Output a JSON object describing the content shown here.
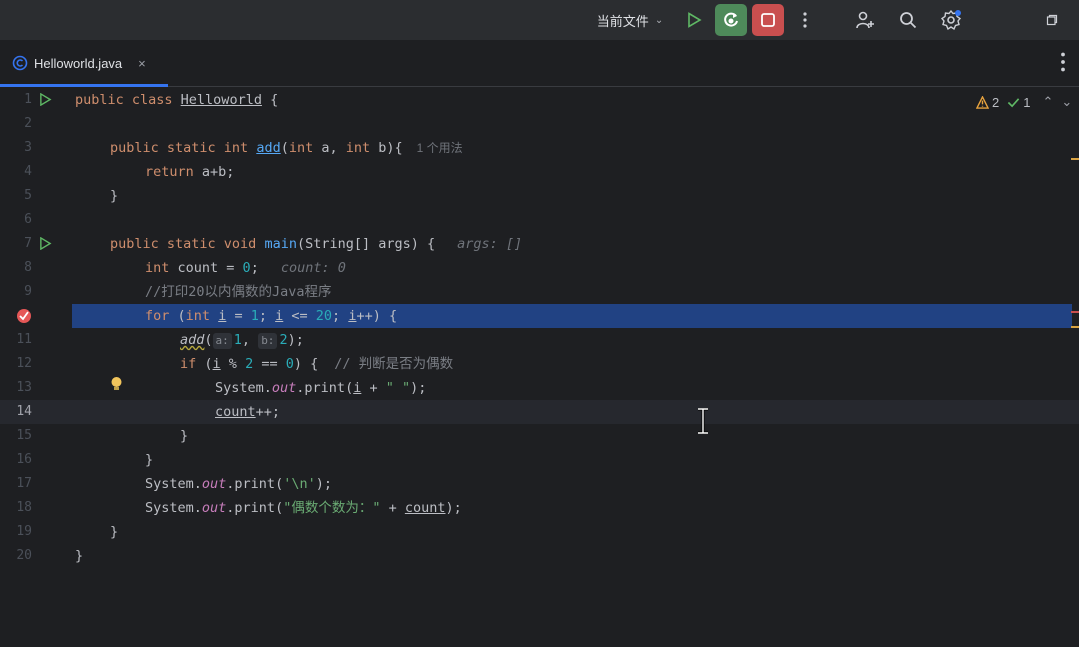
{
  "toolbar": {
    "run_config": "当前文件",
    "icons": [
      "chevron-down-icon",
      "run-icon",
      "rerun-icon",
      "stop-icon",
      "more-icon",
      "add-user-icon",
      "search-icon",
      "settings-icon",
      "window-icon"
    ],
    "colors": {
      "rerun_bg": "#4e8a5a",
      "stop_bg": "#c94f4f",
      "run_green": "#5fb865",
      "accent": "#3574f0"
    }
  },
  "tabs": [
    {
      "label": "Helloworld.java",
      "close": "×"
    }
  ],
  "inspections": {
    "warnings": "2",
    "ok": "1"
  },
  "line_numbers": [
    "1",
    "2",
    "3",
    "4",
    "5",
    "6",
    "7",
    "8",
    "9",
    "10",
    "11",
    "12",
    "13",
    "14",
    "15",
    "16",
    "17",
    "18",
    "19",
    "20"
  ],
  "code": {
    "l1": {
      "kw": "public class ",
      "name": "Helloworld",
      "rest": " {"
    },
    "l3": {
      "kw1": "public static int ",
      "fn": "add",
      "p1": "(",
      "kw2": "int",
      " a": " a, ",
      "kw3": "int",
      "rest": " b){",
      "lens": "1 个用法"
    },
    "l4": {
      "kw": "return",
      "rest": " a+b;"
    },
    "l5": {
      "text": "}"
    },
    "l7": {
      "kw": "public static void ",
      "fn": "main",
      "rest": "(String[] args) {",
      "hint": "args: []"
    },
    "l8": {
      "kw": "int",
      "rest1": " count = ",
      "num": "0",
      "rest2": ";",
      "hint": "count: 0"
    },
    "l9": {
      "cmt": "//打印20以内偶数的Java程序"
    },
    "l10": {
      "kw1": "for",
      "p1": " (",
      "kw2": "int",
      "i1": "i",
      "p2": " = ",
      "n1": "1",
      "p3": "; ",
      "i2": "i",
      "p4": " <= ",
      "n2": "20",
      "p5": "; ",
      "i3": "i",
      "p6": "++) {"
    },
    "l11": {
      "fn": "add",
      "p1": "(",
      "h1": "a:",
      "n1": "1",
      "p2": ", ",
      "h2": "b:",
      "n2": "2",
      "p3": ");"
    },
    "l12": {
      "kw": "if",
      "p1": " (",
      "i": "i",
      "p2": " % ",
      "n1": "2",
      "p3": " == ",
      "n2": "0",
      "p4": ") {",
      "cmt": "// 判断是否为偶数"
    },
    "l13": {
      "p1": "System.",
      "fld": "out",
      "p2": ".print(",
      "i": "i",
      "p3": " + ",
      "str": "\" \"",
      "p4": ");"
    },
    "l14": {
      "v": "count",
      "rest": "++;"
    },
    "l15": {
      "text": "}"
    },
    "l16": {
      "text": "}"
    },
    "l17": {
      "p1": "System.",
      "fld": "out",
      "p2": ".print(",
      "str": "'\\n'",
      "p3": ");"
    },
    "l18": {
      "p1": "System.",
      "fld": "out",
      "p2": ".print(",
      "str": "\"偶数个数为：\"",
      "p3": " + ",
      "v": "count",
      "p4": ");"
    },
    "l19": {
      "text": "}"
    },
    "l20": {
      "text": "}"
    }
  }
}
